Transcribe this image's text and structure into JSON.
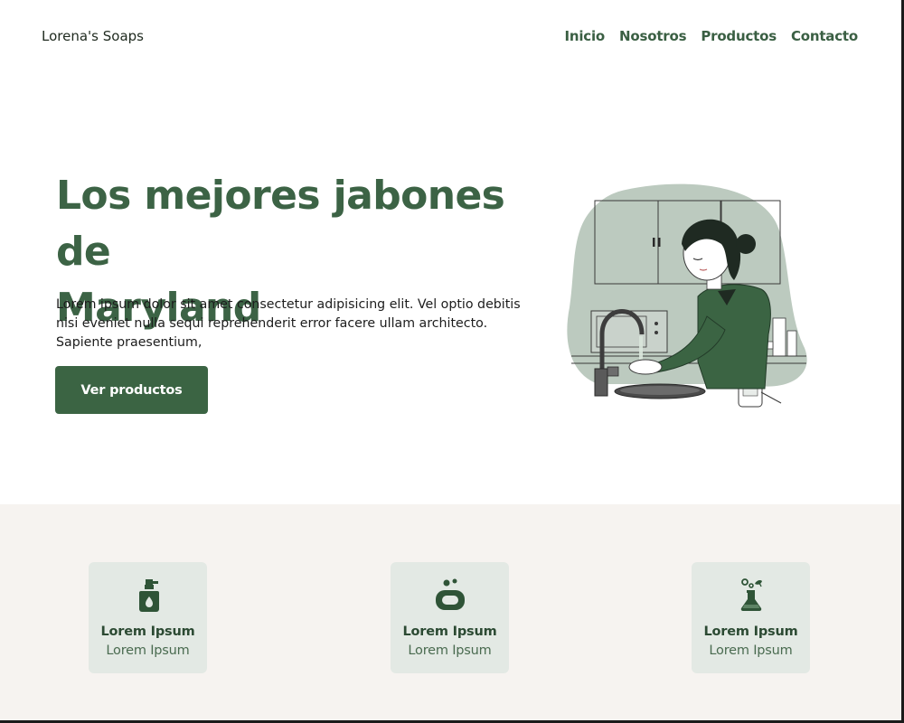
{
  "header": {
    "brand": "Lorena's Soaps",
    "nav": [
      {
        "label": "Inicio"
      },
      {
        "label": "Nosotros"
      },
      {
        "label": "Productos"
      },
      {
        "label": "Contacto"
      }
    ]
  },
  "hero": {
    "title_line1": "Los mejores jabones de",
    "title_line2": "Maryland",
    "description": "Lorem ipsum dolor sit amet consectetur adipisicing elit. Vel optio debitis nisi eveniet nulla sequi reprehenderit error facere ullam architecto. Sapiente praesentium,",
    "cta_label": "Ver productos",
    "illustration": "woman-washing-hands-illustration"
  },
  "features": {
    "cards": [
      {
        "icon": "soap-dispenser-icon",
        "title": "Lorem Ipsum",
        "subtitle": "Lorem Ipsum"
      },
      {
        "icon": "soap-bar-icon",
        "title": "Lorem Ipsum",
        "subtitle": "Lorem Ipsum"
      },
      {
        "icon": "flask-icon",
        "title": "Lorem Ipsum",
        "subtitle": "Lorem Ipsum"
      }
    ]
  },
  "colors": {
    "primary": "#3b6443",
    "card_bg": "#e3e9e4",
    "band_bg": "#f6f3f0",
    "blob": "#bccabf"
  }
}
